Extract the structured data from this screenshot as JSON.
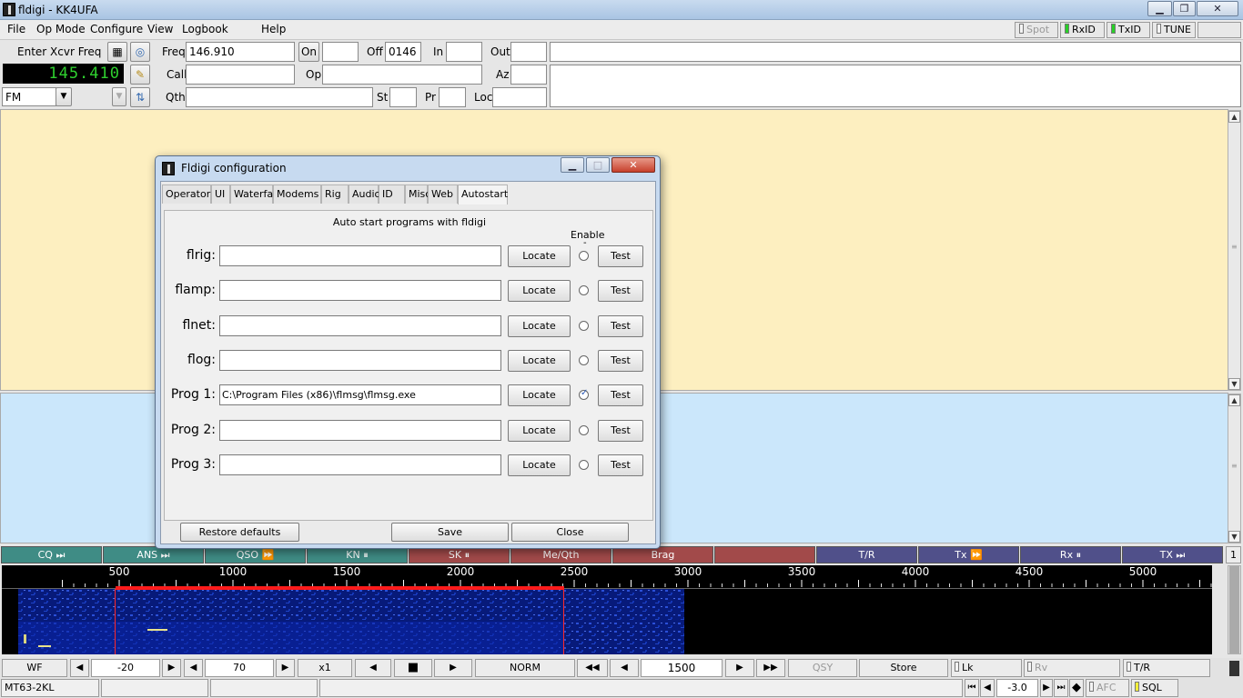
{
  "window": {
    "title": "fldigi - KK4UFA"
  },
  "menu": {
    "items": [
      "File",
      "Op Mode",
      "Configure",
      "View",
      "Logbook",
      "Help"
    ]
  },
  "toggles": {
    "spot": "Spot",
    "rxid": "RxID",
    "txid": "TxID",
    "tune": "TUNE"
  },
  "rig": {
    "enter_label": "Enter Xcvr Freq",
    "freq_display": "145.410",
    "mode": "FM"
  },
  "log": {
    "freq_label": "Freq",
    "freq_value": "146.910",
    "on_label": "On",
    "on_value": "",
    "off_label": "Off",
    "off_value": "0146",
    "in_label": "In",
    "in_value": "",
    "out_label": "Out",
    "out_value": "",
    "call_label": "Call",
    "call_value": "",
    "op_label": "Op",
    "op_value": "",
    "az_label": "Az",
    "az_value": "",
    "qth_label": "Qth",
    "qth_value": "",
    "st_label": "St",
    "st_value": "",
    "pr_label": "Pr",
    "pr_value": "",
    "loc_label": "Loc",
    "loc_value": ""
  },
  "macros": [
    {
      "label": "CQ ⏭",
      "color": "#3f8c85"
    },
    {
      "label": "ANS ⏭",
      "color": "#3f8c85"
    },
    {
      "label": "QSO ⏩",
      "color": "#3f8c85"
    },
    {
      "label": "KN ⏸",
      "color": "#3f8c85"
    },
    {
      "label": "SK ⏸",
      "color": "#a24a4a"
    },
    {
      "label": "Me/Qth",
      "color": "#a24a4a"
    },
    {
      "label": "Brag",
      "color": "#a24a4a"
    },
    {
      "label": "",
      "color": "#a24a4a"
    },
    {
      "label": "T/R",
      "color": "#50508a"
    },
    {
      "label": "Tx ⏩",
      "color": "#50508a"
    },
    {
      "label": "Rx ⏸",
      "color": "#50508a"
    },
    {
      "label": "TX ⏭",
      "color": "#50508a"
    }
  ],
  "macro_bank": "1",
  "scale_ticks": [
    "500",
    "1000",
    "1500",
    "2000",
    "2500",
    "3000",
    "3500",
    "4000",
    "4500",
    "5000"
  ],
  "waterfall_bar": {
    "wf": "WF",
    "ref_level": "-20",
    "range": "70",
    "zoom": "x1",
    "mode": "NORM",
    "carrier": "1500",
    "qsy": "QSY",
    "store": "Store",
    "lk": "Lk",
    "rv": "Rv",
    "tr": "T/R"
  },
  "status": {
    "mode": "MT63-2KL",
    "s2n": "-3.0",
    "afc": "AFC",
    "sql": "SQL"
  },
  "dialog": {
    "title": "Fldigi configuration",
    "tabs": [
      "Operator",
      "UI",
      "Waterfall",
      "Modems",
      "Rig",
      "Audio",
      "ID",
      "Misc",
      "Web",
      "Autostart"
    ],
    "active_tab": "Autostart",
    "heading": "Auto start programs with fldigi",
    "enable_label": "Enable",
    "enable_dash": "-",
    "locate_label": "Locate",
    "test_label": "Test",
    "rows": [
      {
        "label": "flrig:",
        "path": "",
        "enabled": false
      },
      {
        "label": "flamp:",
        "path": "",
        "enabled": false
      },
      {
        "label": "flnet:",
        "path": "",
        "enabled": false
      },
      {
        "label": "flog:",
        "path": "",
        "enabled": false
      },
      {
        "label": "Prog 1:",
        "path": "C:\\Program Files (x86)\\flmsg\\flmsg.exe",
        "enabled": true
      },
      {
        "label": "Prog 2:",
        "path": "",
        "enabled": false
      },
      {
        "label": "Prog 3:",
        "path": "",
        "enabled": false
      }
    ],
    "restore_label": "Restore defaults",
    "save_label": "Save",
    "close_label": "Close"
  }
}
